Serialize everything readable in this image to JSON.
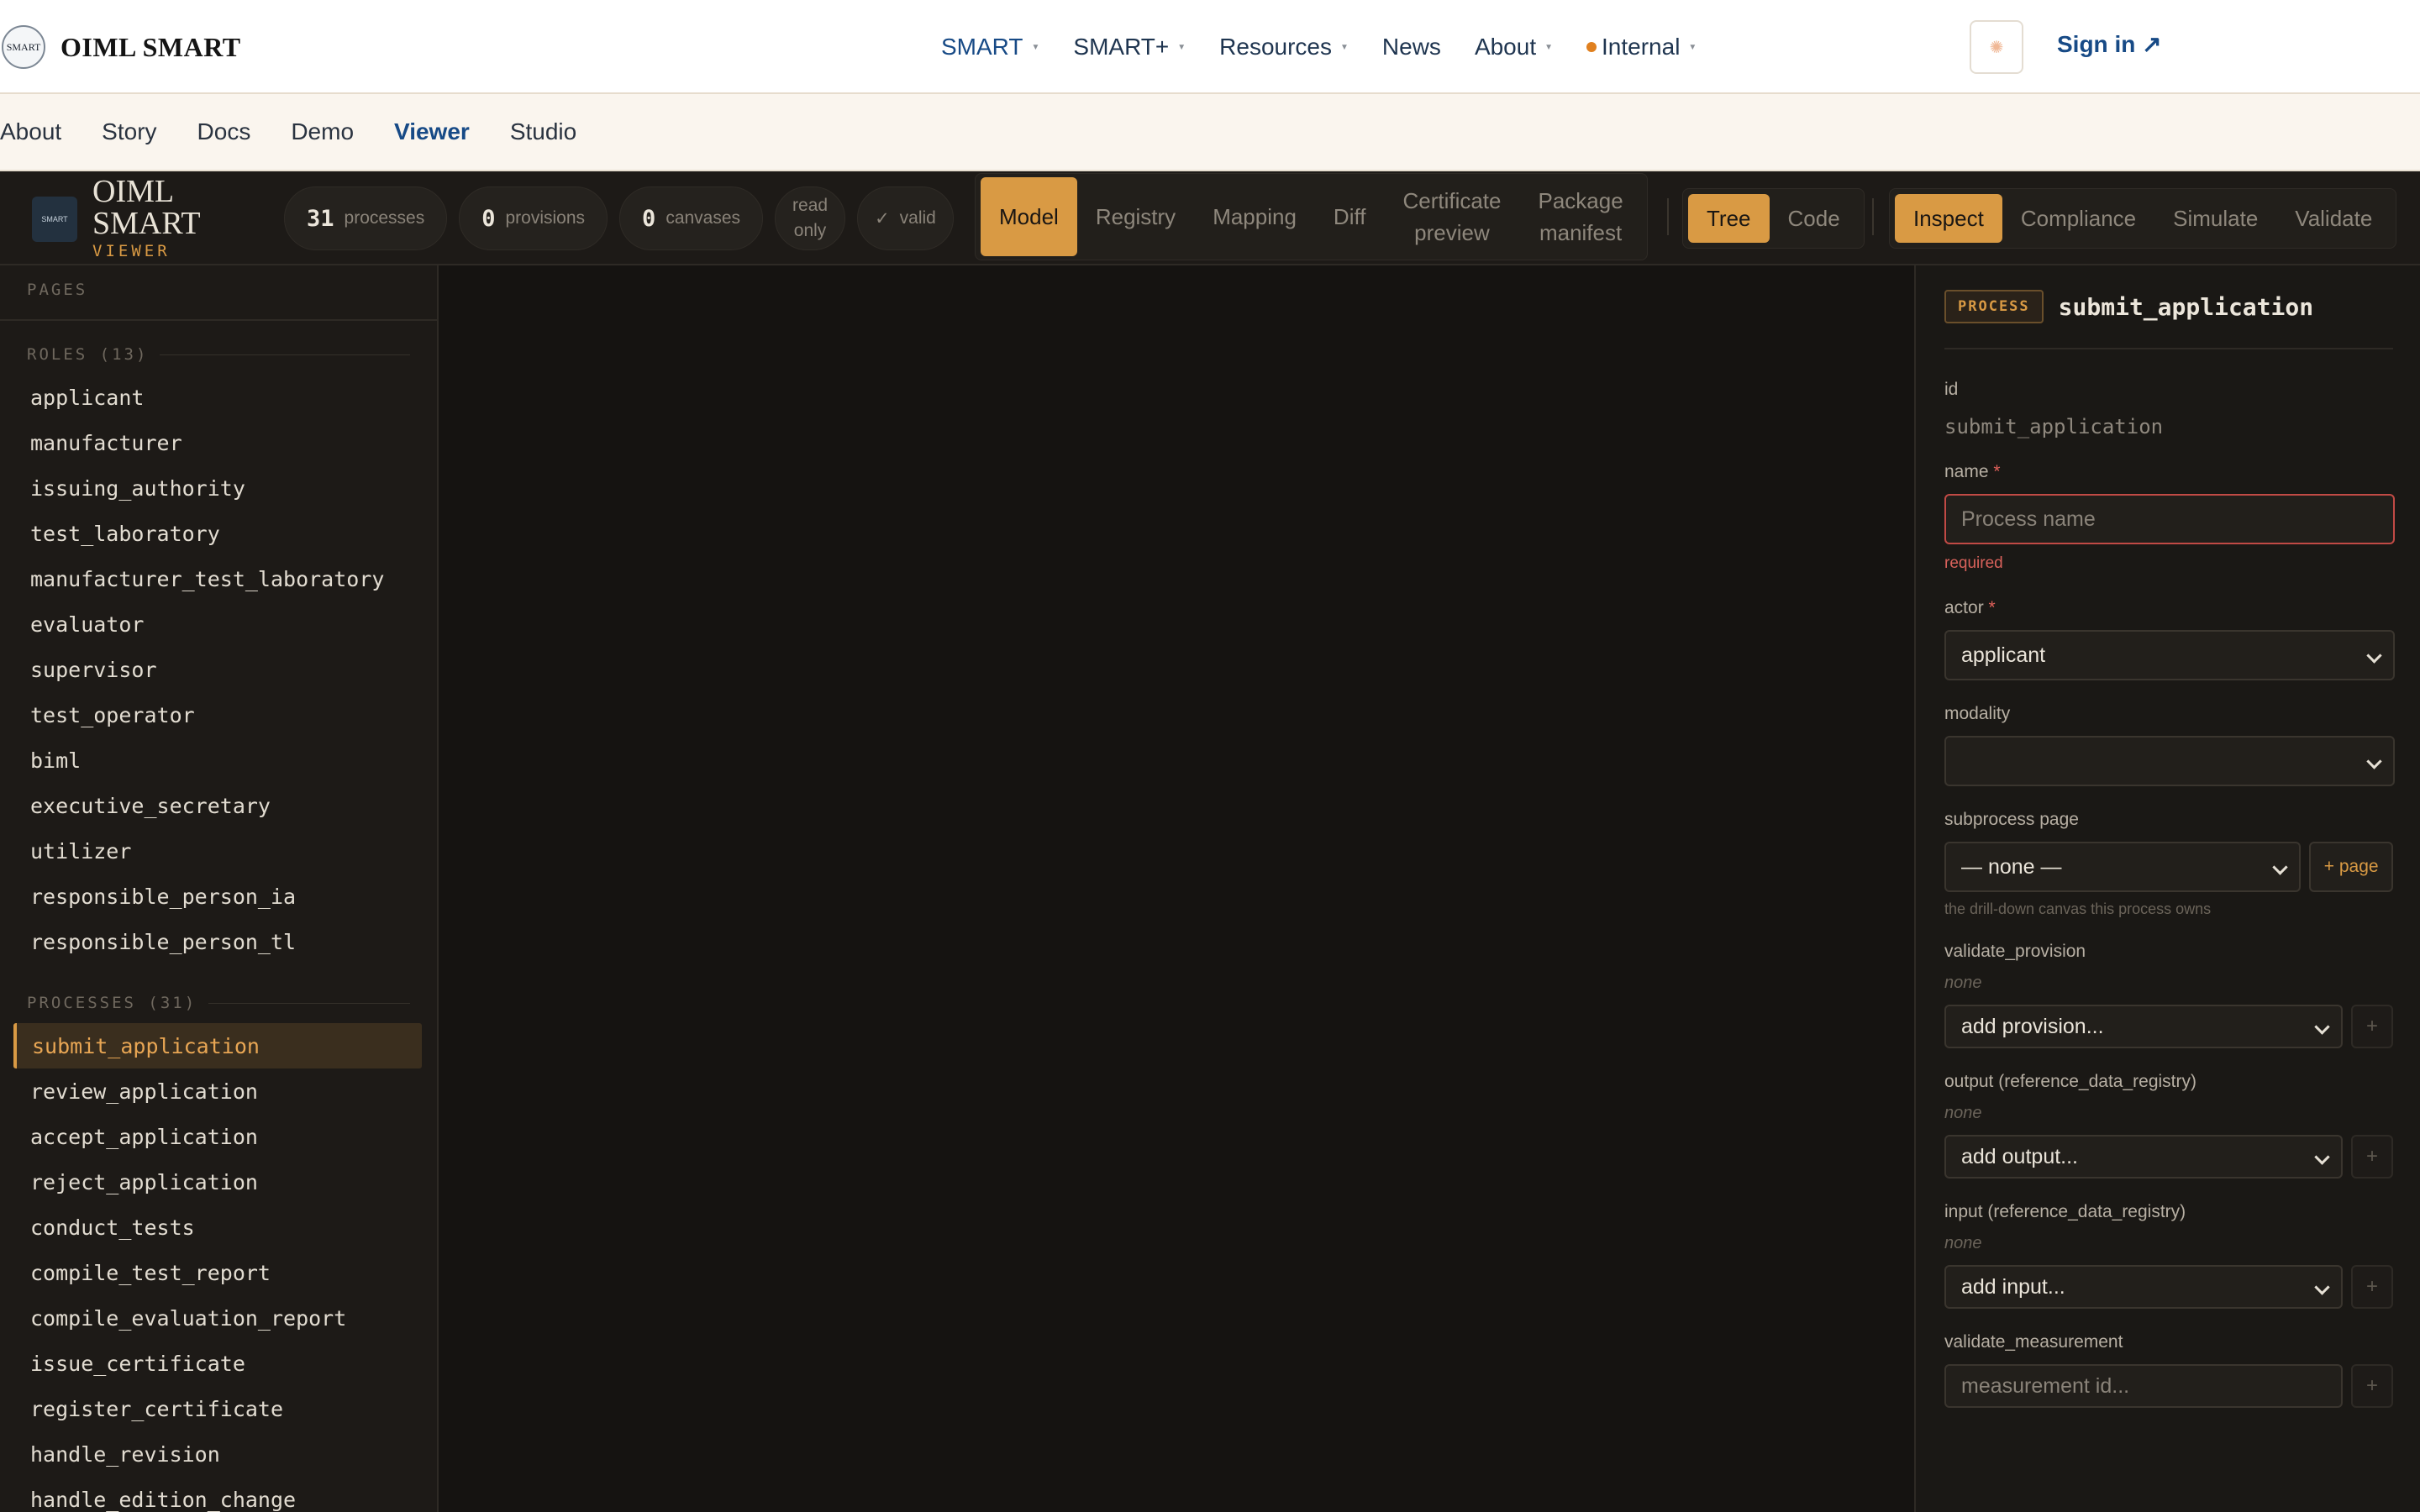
{
  "site": {
    "brand": "OIML SMART",
    "brand_seal": "SMART",
    "menu": [
      {
        "label": "SMART",
        "caret": true,
        "active": true
      },
      {
        "label": "SMART+",
        "caret": true
      },
      {
        "label": "Resources",
        "caret": true
      },
      {
        "label": "News",
        "caret": false
      },
      {
        "label": "About",
        "caret": true
      },
      {
        "label": "Internal",
        "caret": true,
        "dot": true
      }
    ],
    "signin": "Sign in ↗"
  },
  "subnav": [
    "About",
    "Story",
    "Docs",
    "Demo",
    "Viewer",
    "Studio"
  ],
  "subnav_active": "Viewer",
  "app": {
    "title_line1": "OIML",
    "title_line2": "SMART",
    "subtitle": "VIEWER",
    "logo_text": "SMART",
    "stats": {
      "processes": {
        "num": "31",
        "label": "processes"
      },
      "provisions": {
        "num": "0",
        "label": "provisions"
      },
      "canvases": {
        "num": "0",
        "label": "canvases"
      },
      "readonly": {
        "line1": "read",
        "line2": "only"
      },
      "valid": {
        "check": "✓",
        "label": "valid"
      }
    },
    "main_tabs": [
      {
        "label": "Model",
        "active": true
      },
      {
        "label": "Registry"
      },
      {
        "label": "Mapping"
      },
      {
        "label": "Diff"
      },
      {
        "label": "Certificate preview",
        "l1": "Certificate",
        "l2": "preview"
      },
      {
        "label": "Package manifest",
        "l1": "Package",
        "l2": "manifest"
      }
    ],
    "view_tabs": [
      {
        "label": "Tree",
        "active": true
      },
      {
        "label": "Code"
      }
    ],
    "right_tabs": [
      {
        "label": "Inspect",
        "active": true
      },
      {
        "label": "Compliance"
      },
      {
        "label": "Simulate"
      },
      {
        "label": "Validate"
      }
    ]
  },
  "sidebar": {
    "pages_header": "PAGES",
    "roles_header": "ROLES (13)",
    "roles": [
      "applicant",
      "manufacturer",
      "issuing_authority",
      "test_laboratory",
      "manufacturer_test_laboratory",
      "evaluator",
      "supervisor",
      "test_operator",
      "biml",
      "executive_secretary",
      "utilizer",
      "responsible_person_ia",
      "responsible_person_tl"
    ],
    "processes_header": "PROCESSES (31)",
    "processes": [
      "submit_application",
      "review_application",
      "accept_application",
      "reject_application",
      "conduct_tests",
      "compile_test_report",
      "compile_evaluation_report",
      "issue_certificate",
      "register_certificate",
      "handle_revision",
      "handle_edition_change"
    ],
    "selected_process": "submit_application"
  },
  "inspector": {
    "badge": "PROCESS",
    "title": "submit_application",
    "id_label": "id",
    "id_value": "submit_application",
    "name_label": "name",
    "name_placeholder": "Process name",
    "required_mark": "*",
    "required_text": "required",
    "actor_label": "actor",
    "actor_value": "applicant",
    "modality_label": "modality",
    "modality_value": "",
    "subprocess_label": "subprocess page",
    "subprocess_value": "— none —",
    "add_page": "+ page",
    "subprocess_hint": "the drill-down canvas this process owns",
    "validate_provision_label": "validate_provision",
    "validate_provision_none": "none",
    "validate_provision_select": "add provision...",
    "output_label": "output (reference_data_registry)",
    "output_none": "none",
    "output_select": "add output...",
    "input_label": "input (reference_data_registry)",
    "input_none": "none",
    "input_select": "add input...",
    "validate_measurement_label": "validate_measurement",
    "validate_measurement_placeholder": "measurement id...",
    "plus": "+"
  },
  "colors": {
    "accent": "#d99a44",
    "link": "#174a86",
    "error": "#c14a45",
    "bg": "#151311"
  }
}
